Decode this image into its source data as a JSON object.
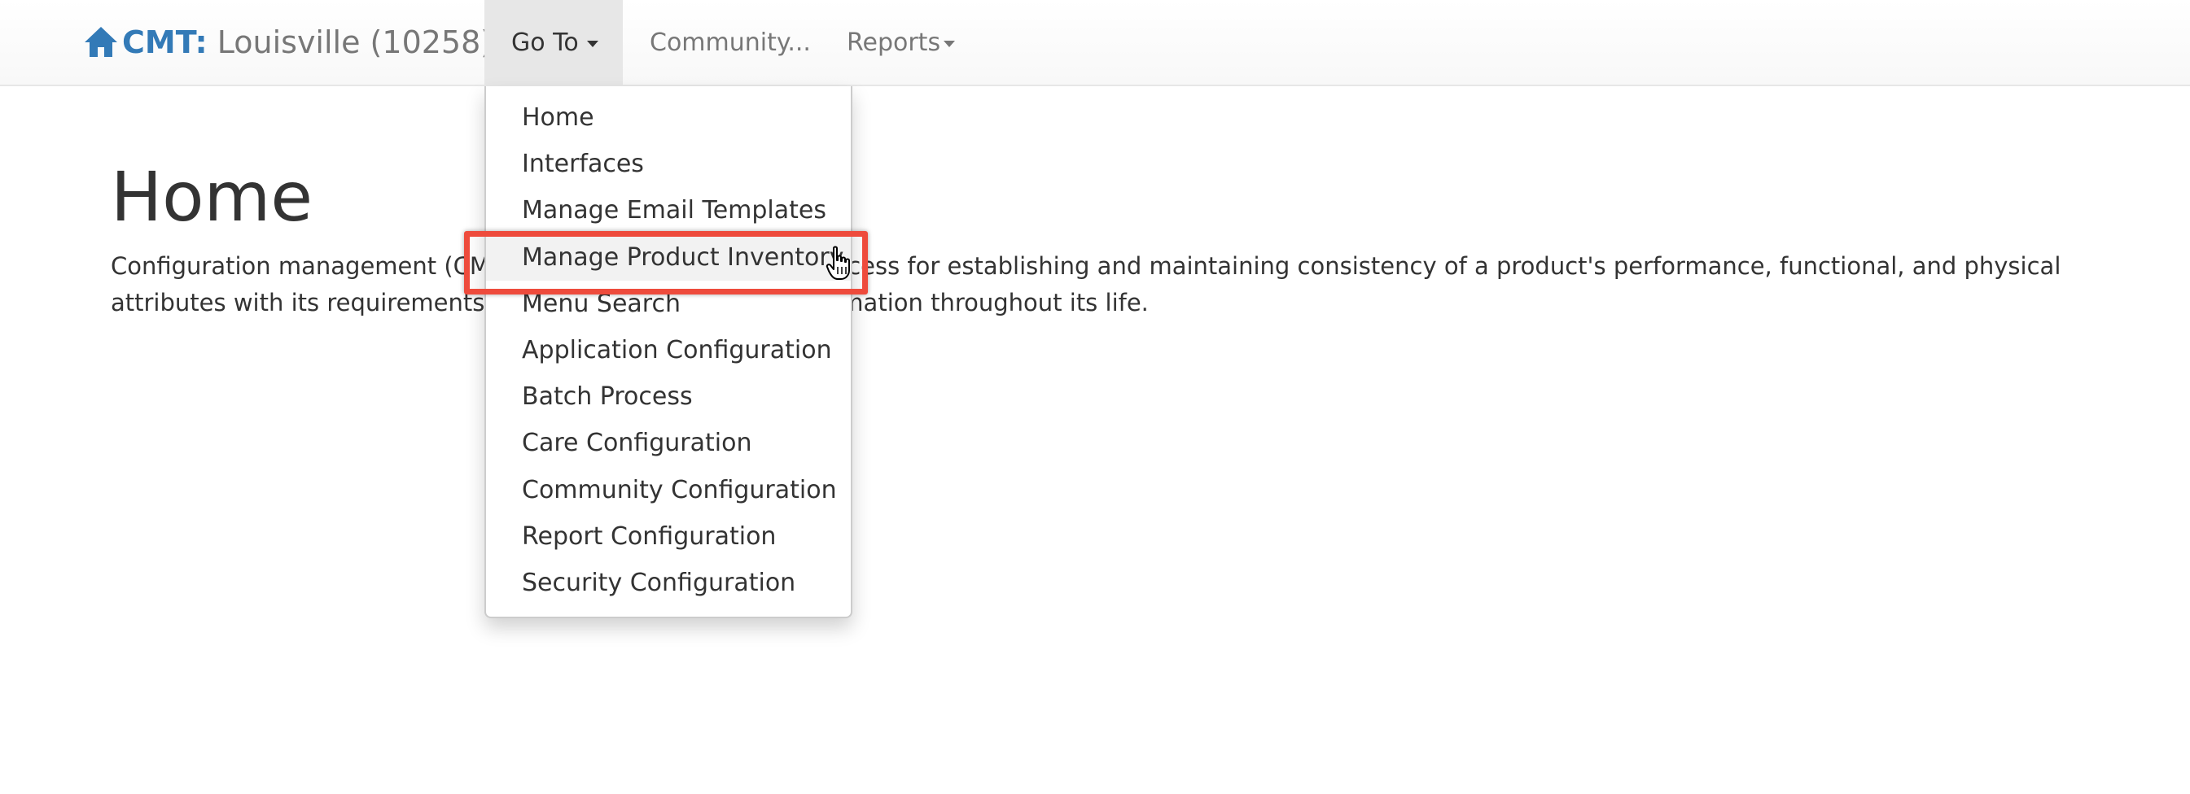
{
  "app": {
    "brand": "CMT:",
    "location": "Louisville (10258)",
    "brand_color": "#337ab7"
  },
  "nav": {
    "goto_label": "Go To",
    "community_label": "Community...",
    "reports_label": "Reports"
  },
  "dropdown": {
    "items": [
      {
        "label": "Home"
      },
      {
        "label": "Interfaces"
      },
      {
        "label": "Manage Email Templates"
      },
      {
        "label": "Manage Product Inventory"
      },
      {
        "label": "Menu Search"
      },
      {
        "label": "Application Configuration"
      },
      {
        "label": "Batch Process"
      },
      {
        "label": "Care Configuration"
      },
      {
        "label": "Community Configuration"
      },
      {
        "label": "Report Configuration"
      },
      {
        "label": "Security Configuration"
      }
    ],
    "highlighted_item": "Manage Product Inventory",
    "highlight_color": "#ee4b3c"
  },
  "page": {
    "title": "Home",
    "description": "Configuration management (CM) is a systems engineering process for establishing and maintaining consistency of a product's performance, functional, and physical attributes with its requirements, design, and operational information throughout its life."
  },
  "icons": {
    "brand_icon": "home-icon",
    "cursor": "hand-pointer-icon"
  }
}
